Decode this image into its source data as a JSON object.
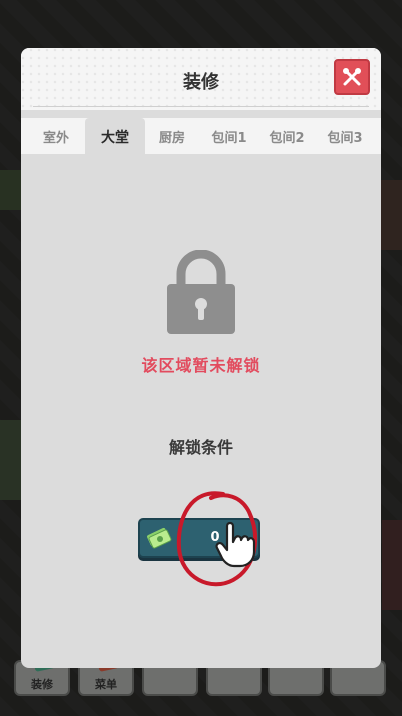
{
  "dialog": {
    "title": "装修",
    "close_icon": "close-fork-knife-icon"
  },
  "tabs": [
    {
      "label": "室外",
      "active": false
    },
    {
      "label": "大堂",
      "active": true
    },
    {
      "label": "厨房",
      "active": false
    },
    {
      "label": "包间1",
      "active": false
    },
    {
      "label": "包间2",
      "active": false
    },
    {
      "label": "包间3",
      "active": false
    }
  ],
  "locked": {
    "icon": "padlock-icon",
    "message": "该区域暂未解锁"
  },
  "unlock": {
    "title": "解锁条件",
    "requirement_icon": "money-icon",
    "requirement_value": "0"
  },
  "bottom_bar": {
    "items": [
      {
        "label": "装修"
      },
      {
        "label": "菜单"
      }
    ]
  },
  "colors": {
    "accent_red": "#e14f58",
    "lock_text": "#e24b5e",
    "card_teal": "#2d6170",
    "panel_bg": "#dcdcdc"
  }
}
